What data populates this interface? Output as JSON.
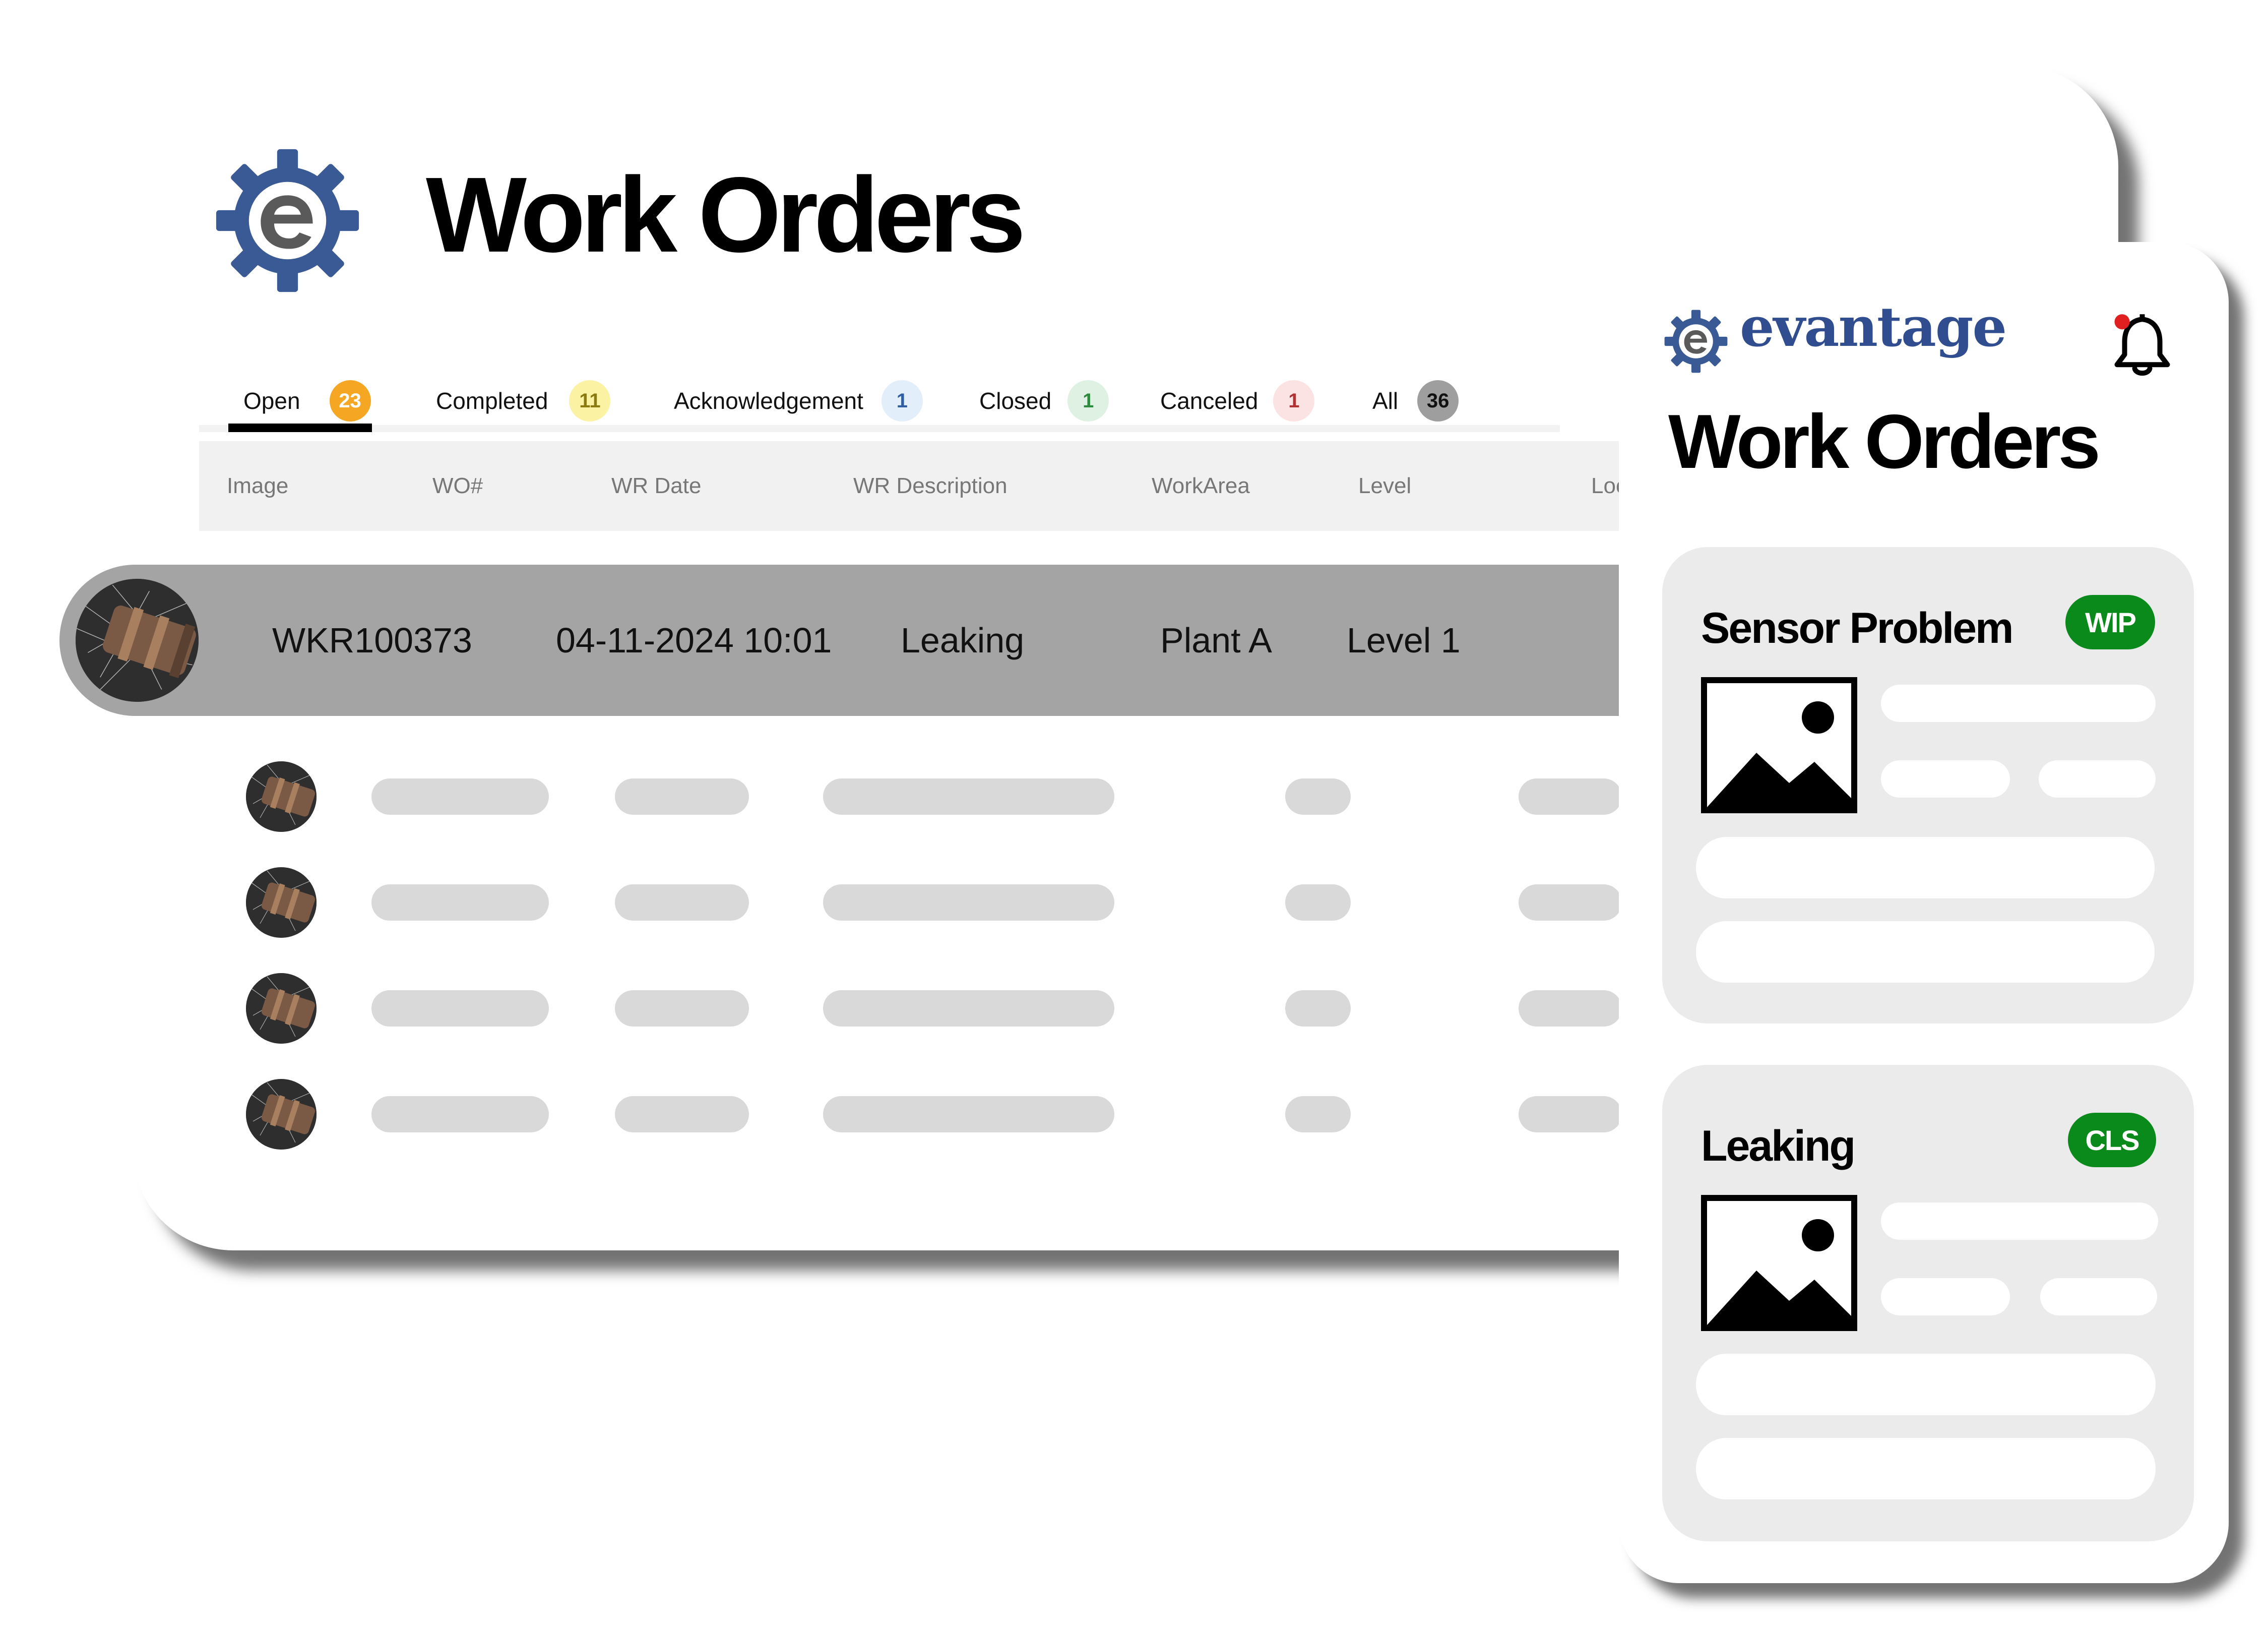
{
  "desktop": {
    "title": "Work Orders",
    "tabs": [
      {
        "label": "Open",
        "count": "23",
        "badge_bg": "#f5a623",
        "badge_fg": "#ffffff",
        "active": true
      },
      {
        "label": "Completed",
        "count": "11",
        "badge_bg": "#fbf3a3",
        "badge_fg": "#8a7a10",
        "active": false
      },
      {
        "label": "Acknowledgement",
        "count": "1",
        "badge_bg": "#e3eefb",
        "badge_fg": "#2f5fa0",
        "active": false
      },
      {
        "label": "Closed",
        "count": "1",
        "badge_bg": "#dff1e2",
        "badge_fg": "#2e8a3e",
        "active": false
      },
      {
        "label": "Canceled",
        "count": "1",
        "badge_bg": "#fbe3e3",
        "badge_fg": "#b13232",
        "active": false
      },
      {
        "label": "All",
        "count": "36",
        "badge_bg": "#9e9e9e",
        "badge_fg": "#111111",
        "active": false
      }
    ],
    "columns": [
      "Image",
      "WO#",
      "WR Date",
      "WR Description",
      "WorkArea",
      "Level",
      "Loc"
    ],
    "selected_row": {
      "wo": "WKR100373",
      "date": "04-11-2024 10:01",
      "description": "Leaking",
      "workarea": "Plant A",
      "level": "Level 1",
      "image_icon": "pipe-photo"
    },
    "placeholder_rows": 4
  },
  "mobile": {
    "brand": "evantage",
    "notification_icon": "bell-icon",
    "notification_dot_color": "#e02020",
    "title": "Work Orders",
    "cards": [
      {
        "title": "Sensor Problem",
        "status": "WIP",
        "image_icon": "image-placeholder-icon"
      },
      {
        "title": "Leaking",
        "status": "CLS",
        "image_icon": "image-placeholder-icon"
      }
    ]
  },
  "colors": {
    "brand_blue": "#3a5a96",
    "status_green": "#0a8a1a",
    "selected_row_bg": "#a4a4a4",
    "skeleton": "#d9d9d9"
  }
}
